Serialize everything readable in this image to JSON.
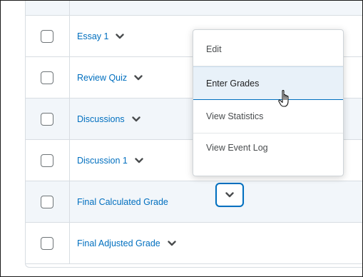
{
  "grade_items": [
    {
      "name": "Essay 1"
    },
    {
      "name": "Review Quiz"
    },
    {
      "name": "Discussions"
    },
    {
      "name": "Discussion 1"
    },
    {
      "name": "Final Calculated Grade"
    },
    {
      "name": "Final Adjusted Grade"
    }
  ],
  "context_menu": {
    "items": [
      {
        "label": "Edit"
      },
      {
        "label": "Enter Grades"
      },
      {
        "label": "View Statistics"
      },
      {
        "label": "View Event Log"
      }
    ],
    "highlighted": "Enter Grades"
  },
  "icons": {
    "chevron": "chevron-down-icon",
    "cursor": "hand-pointer-icon"
  },
  "colors": {
    "link": "#006fbf",
    "row_alt": "#f2f6fa",
    "menu_highlight": "#e8f1f9"
  }
}
